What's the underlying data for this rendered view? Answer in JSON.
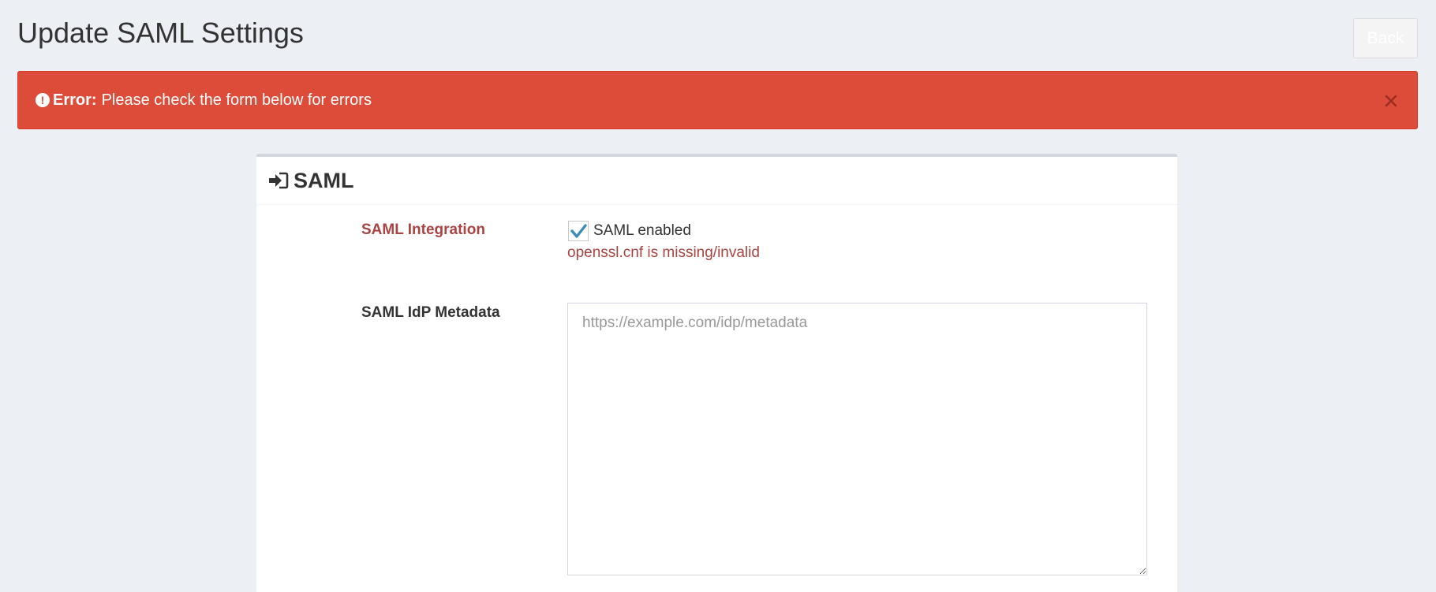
{
  "header": {
    "title": "Update SAML Settings",
    "back_label": "Back"
  },
  "alert": {
    "icon": "exclamation-circle-icon",
    "strong": "Error:",
    "message": "Please check the form below for errors",
    "close_icon": "close-icon",
    "color": "#dd4b39"
  },
  "panel": {
    "icon": "sign-in-icon",
    "title": "SAML"
  },
  "form": {
    "saml_integration": {
      "label": "SAML Integration",
      "checkbox_label": "SAML enabled",
      "checked": true,
      "error": "openssl.cnf is missing/invalid"
    },
    "idp_metadata": {
      "label": "SAML IdP Metadata",
      "value": "",
      "placeholder": "https://example.com/idp/metadata"
    }
  },
  "colors": {
    "background": "#ecf0f5",
    "error_text": "#a94442",
    "checkmark": "#3c8dbc"
  }
}
